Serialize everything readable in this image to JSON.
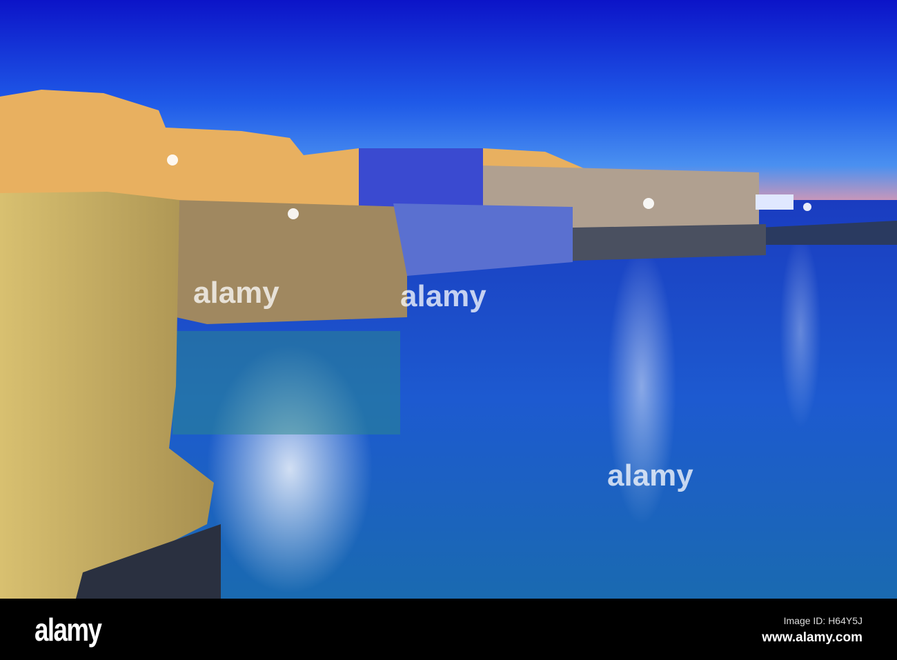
{
  "photo": {
    "subject": "coastal town on cliffs at night"
  },
  "watermark": {
    "brand": "alamy"
  },
  "footer": {
    "logo": "alamy",
    "image_id": "Image ID: H64Y5J",
    "website": "www.alamy.com"
  },
  "colors": {
    "sky_top": "#1a1fd8",
    "sky_horizon": "#e88aa0",
    "sea": "#1e4fd0",
    "cliff": "#c8b060"
  }
}
